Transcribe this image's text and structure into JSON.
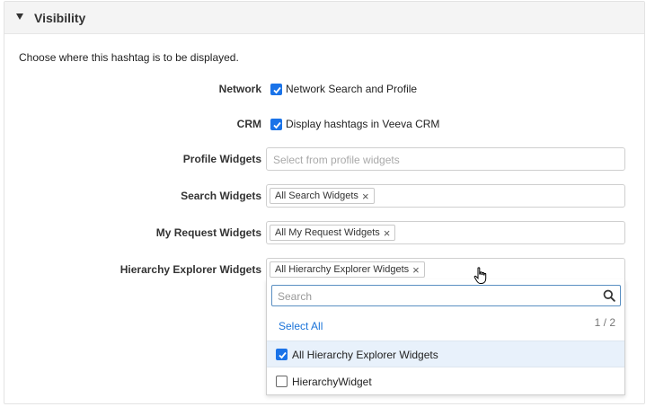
{
  "section": {
    "title": "Visibility"
  },
  "intro": "Choose where this hashtag is to be displayed.",
  "fields": {
    "network": {
      "label": "Network",
      "checkbox_label": "Network Search and Profile",
      "checked": true
    },
    "crm": {
      "label": "CRM",
      "checkbox_label": "Display hashtags in Veeva CRM",
      "checked": true
    },
    "profile_widgets": {
      "label": "Profile Widgets",
      "placeholder": "Select from profile widgets"
    },
    "search_widgets": {
      "label": "Search Widgets",
      "tag": "All Search Widgets"
    },
    "my_request_widgets": {
      "label": "My Request Widgets",
      "tag": "All My Request Widgets"
    },
    "hierarchy_explorer_widgets": {
      "label": "Hierarchy Explorer Widgets",
      "tag": "All Hierarchy Explorer Widgets"
    }
  },
  "dropdown": {
    "search_placeholder": "Search",
    "select_all": "Select All",
    "count": "1 / 2",
    "options": [
      {
        "label": "All Hierarchy Explorer Widgets",
        "checked": true
      },
      {
        "label": "HierarchyWidget",
        "checked": false
      }
    ]
  },
  "colors": {
    "accent": "#1a73e8",
    "link": "#1a73d9",
    "selected_row": "#e8f1fb"
  }
}
